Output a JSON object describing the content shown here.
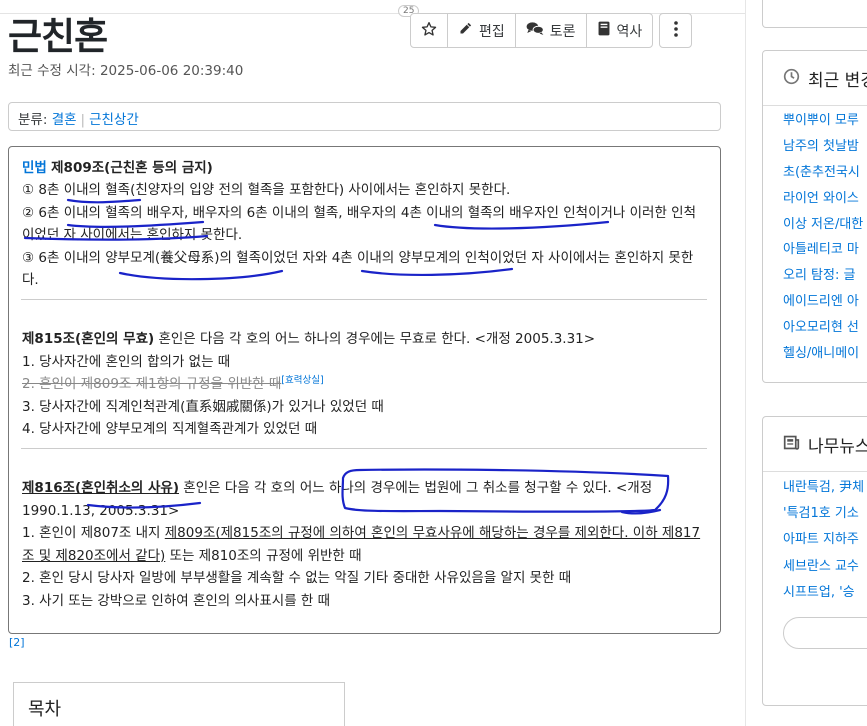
{
  "page": {
    "title": "근친혼",
    "modified": "최근 수정 시각: 2025-06-06 20:39:40",
    "count_badge": "25"
  },
  "toolbar": {
    "star_icon": "star-outline-icon",
    "edit_label": "편집",
    "discuss_label": "토론",
    "history_label": "역사",
    "more_icon": "vertical-dots-icon"
  },
  "category": {
    "label": "분류",
    "items": [
      "결혼",
      "근친상간"
    ]
  },
  "law": {
    "a809_prefix": "민법",
    "a809_title": "제809조(근친혼 등의 금지)",
    "a809_lines": [
      "① 8촌 이내의 혈족(친양자의 입양 전의 혈족을 포함한다) 사이에서는 혼인하지 못한다.",
      "② 6촌 이내의 혈족의 배우자, 배우자의 6촌 이내의 혈족, 배우자의 4촌 이내의 혈족의 배우자인 인척이거나 이러한 인척이었던 자 사이에서는 혼인하지 못한다.",
      "③ 6촌 이내의 양부모계(養父母系)의 혈족이었던 자와 4촌 이내의 양부모계의 인척이었던 자 사이에서는 혼인하지 못한다."
    ],
    "a815_title": "제815조(혼인의 무효)",
    "a815_intro": " 혼인은 다음 각 호의 어느 하나의 경우에는 무효로 한다. <개정 2005.3.31>",
    "a815_items": [
      "1. 당사자간에 혼인의 합의가 없는 때",
      "2. 혼인이 제809조 제1항의 규정을 위반한 때",
      "3. 당사자간에 직계인척관계(直系姻戚關係)가 있거나 있었던 때",
      "4. 당사자간에 양부모계의 직계혈족관계가 있었던 때"
    ],
    "a815_repealed": "[효력상실]",
    "a816_title": "제816조(혼인취소의 사유)",
    "a816_intro": " 혼인은 다음 각 호의 어느 하나의 경우에는 법원에 그 취소를 청구할 수 있다. <개정 1990.1.13, 2005.3.31>",
    "a816_item1_pre": "1. 혼인이 제807조 내지 ",
    "a816_item1_ul": "제809조(제815조의 규정에 의하여 혼인의 무효사유에 해당하는 경우를 제외한다. 이하 제817조 및 제820조에서 같다)",
    "a816_item1_post": " 또는 제810조의 규정에 위반한 때",
    "a816_items": [
      "2. 혼인 당시 당사자 일방에 부부생활을 계속할 수 없는 악질 기타 중대한 사유있음을 알지 못한 때",
      "3. 사기 또는 강박으로 인하여 혼인의 의사표시를 한 때"
    ]
  },
  "footnote_ref": "[2]",
  "toc": {
    "title": "목차"
  },
  "sidebar": {
    "top_fragment": "·  ·",
    "recent": {
      "icon": "clock-icon",
      "title": "최근 변경",
      "items": [
        "뿌이뿌이 모루",
        "남주의 첫날밤",
        "초(춘추전국시",
        "라이언 와이스",
        "이상 저온/대한",
        "아틀레티코 마",
        "오리 탐정: 글",
        "에이드리엔 아",
        "아오모리현 선",
        "헬싱/애니메이"
      ]
    },
    "news": {
      "icon": "news-icon",
      "title": "나무뉴스",
      "items": [
        "내란특검, 尹체",
        "'특검1호 기소",
        "아파트 지하주",
        "세브란스 교수",
        "시프트업, '승"
      ]
    }
  }
}
